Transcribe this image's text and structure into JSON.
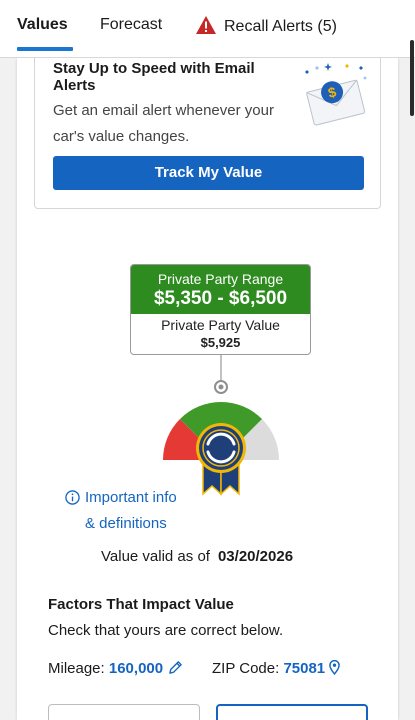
{
  "tabs": [
    {
      "label": "Values",
      "active": true
    },
    {
      "label": "Forecast",
      "active": false
    },
    {
      "label": "Recall Alerts (5)",
      "active": false,
      "icon": "warning-triangle-icon"
    }
  ],
  "email_card": {
    "title": "Stay Up to Speed with Email Alerts",
    "description": "Get an email alert whenever your car's value changes.",
    "button_label": "Track My Value",
    "illustration": "email-dollar-envelope-icon"
  },
  "price": {
    "range_label": "Private Party Range",
    "range_value": "$5,350 - $6,500",
    "value_label": "Private Party Value",
    "value": "$5,925"
  },
  "gauge": {
    "segments": [
      "red",
      "green",
      "gray"
    ],
    "badge_icon": "kbb-ribbon-badge-icon"
  },
  "info": {
    "line1": "Important info",
    "line2": "& definitions"
  },
  "valid": {
    "label": "Value valid as of",
    "date": "03/20/2026"
  },
  "factors": {
    "title": "Factors That Impact Value",
    "subtitle": "Check that yours are correct below.",
    "mileage_label": "Mileage:",
    "mileage_value": "160,000",
    "zip_label": "ZIP Code:",
    "zip_value": "75081"
  },
  "colors": {
    "accent_blue": "#1565c0",
    "range_green": "#2e8b1f",
    "gauge_red": "#e53935",
    "gauge_green": "#3f9a2a",
    "gauge_gray": "#dcdcdc",
    "badge_navy": "#1f3f78",
    "badge_gold": "#f2b705",
    "warning_red": "#c62828"
  }
}
